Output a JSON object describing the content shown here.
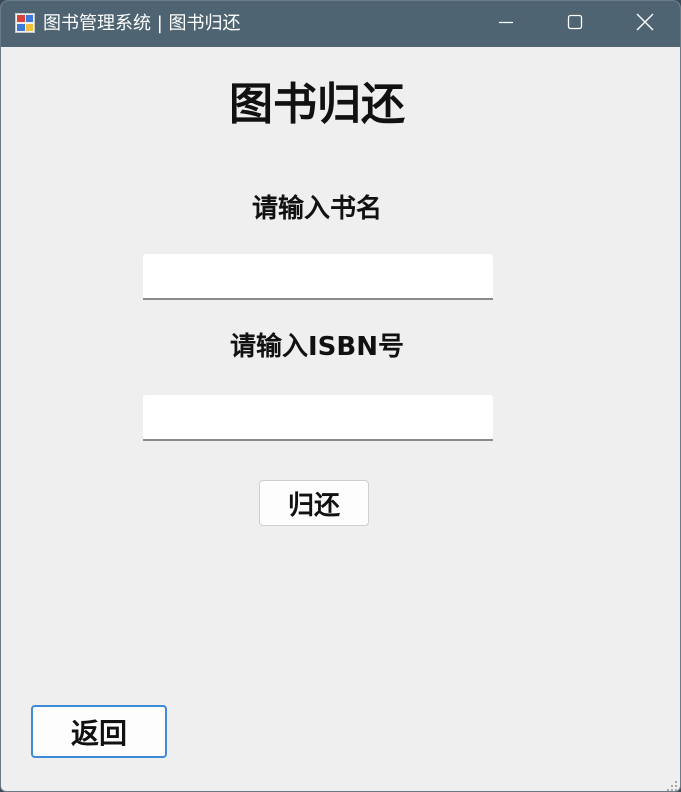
{
  "window": {
    "title": "图书管理系统 | 图书归还",
    "app_icon": "app-window-icon",
    "controls": {
      "minimize_icon": "minimize-icon",
      "maximize_icon": "maximize-icon",
      "close_icon": "close-icon"
    }
  },
  "form": {
    "heading": "图书归还",
    "book_name_label": "请输入书名",
    "book_name_value": "",
    "isbn_label": "请输入ISBN号",
    "isbn_value": "",
    "return_button_label": "归还",
    "back_button_label": "返回"
  },
  "colors": {
    "titlebar": "#4e6472",
    "window_background": "#efefef",
    "focus_border": "#3f8ad8"
  }
}
